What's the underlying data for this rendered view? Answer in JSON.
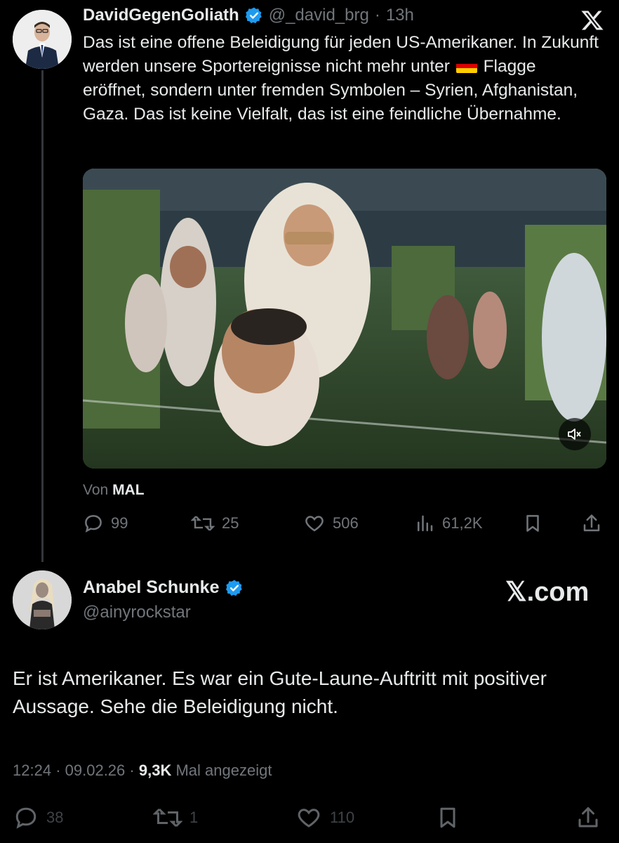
{
  "tweet": {
    "author_name": "DavidGegenGoliath",
    "handle": "@_david_brg",
    "separator": "·",
    "time": "13h",
    "text_parts": [
      "Das ist eine offene Beleidigung für jeden US-Amerikaner. In Zukunft werden unsere Sportereignisse nicht mehr unter",
      "Flagge eröffnet, sondern unter fremden Symbolen – Syrien, Afghanistan, Gaza. Das ist keine Vielfalt, das ist eine feindliche Übernahme."
    ],
    "flag_emoji": "germany-flag",
    "source_prefix": "Von",
    "source_name": "MAL",
    "actions": {
      "replies": "99",
      "reposts": "25",
      "likes": "506",
      "views": "61,2K"
    }
  },
  "reply": {
    "author_name": "Anabel Schunke",
    "handle": "@ainyrockstar",
    "text": "Er ist Amerikaner. Es war ein Gute-Laune-Auftritt mit positiver Aussage. Sehe die Beleidigung nicht.",
    "time": "12:24",
    "date": "09.02.26",
    "sep": "·",
    "views": "9,3K",
    "views_label": "Mal angezeigt",
    "actions": {
      "replies": "38",
      "reposts": "1",
      "likes": "110"
    }
  },
  "watermark": "𝕏.com",
  "colors": {
    "background": "#000000",
    "text": "#e7e9ea",
    "muted": "#71767b",
    "verified": "#1d9bf0"
  }
}
